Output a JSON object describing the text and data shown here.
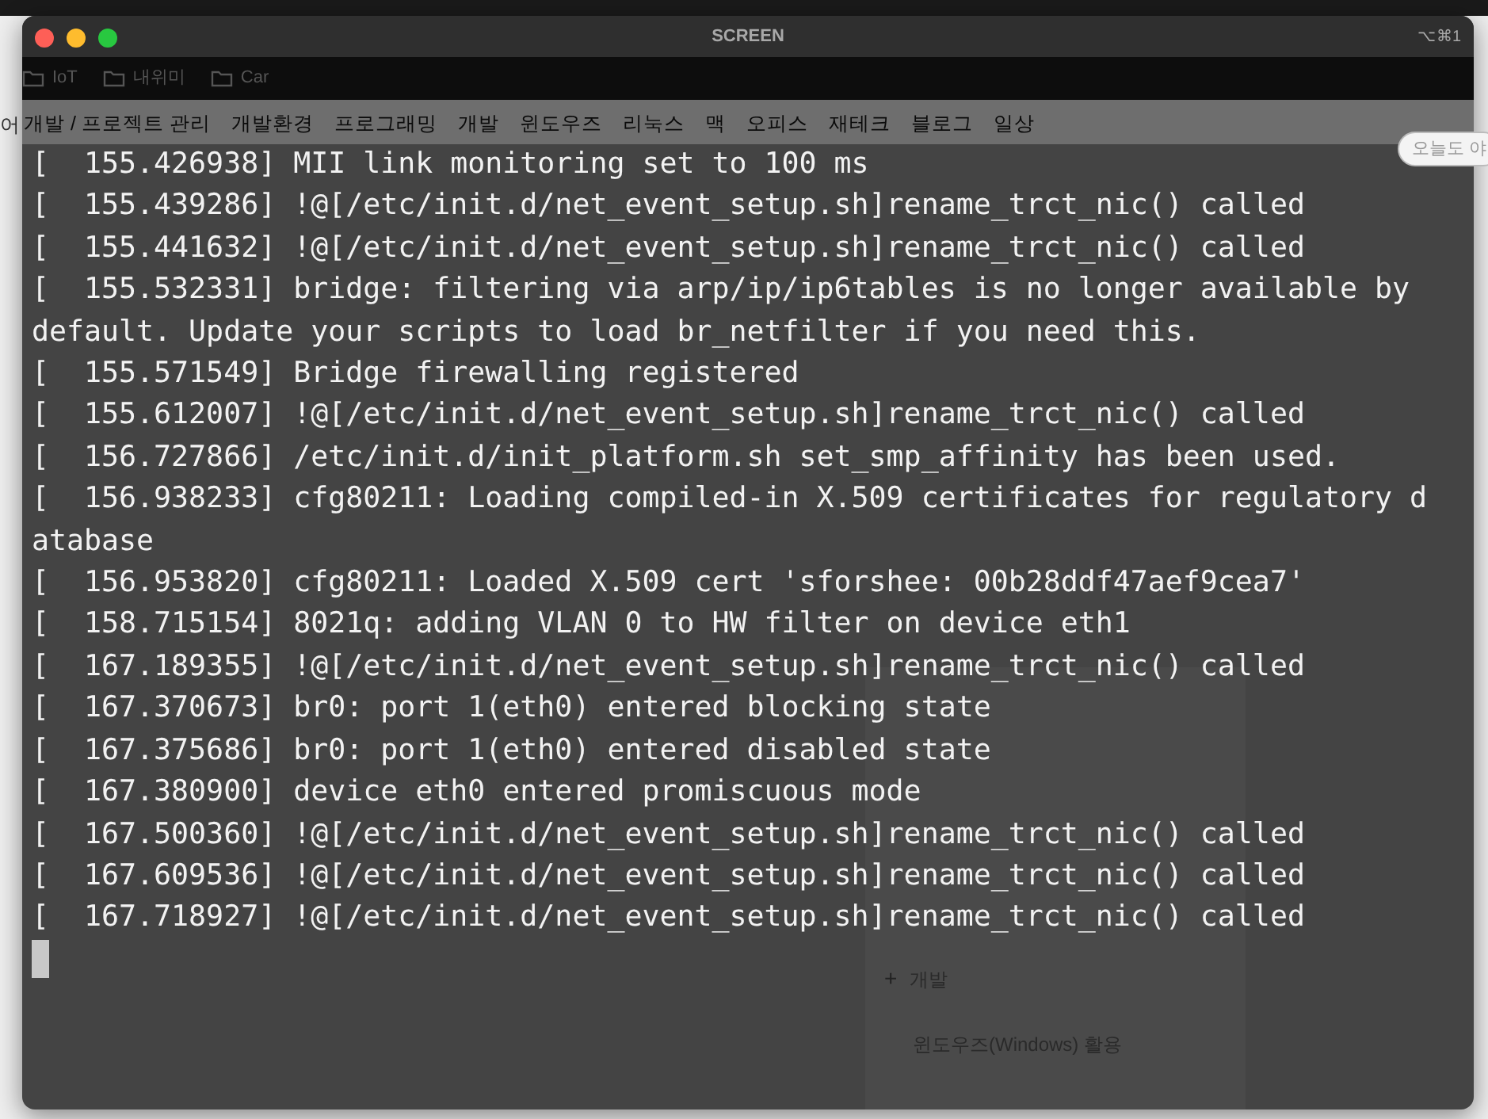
{
  "browser": {
    "nav_cut": "어",
    "badge": "오늘도 야",
    "bookmarks": [
      {
        "label": "IoT"
      },
      {
        "label": "내위미"
      },
      {
        "label": "Car"
      }
    ],
    "nav": [
      {
        "label": "개발 / 프로젝트 관리"
      },
      {
        "label": "개발환경"
      },
      {
        "label": "프로그래밍"
      },
      {
        "label": "개발"
      },
      {
        "label": "윈도우즈"
      },
      {
        "label": "리눅스"
      },
      {
        "label": "맥"
      },
      {
        "label": "오피스"
      },
      {
        "label": "재테크"
      },
      {
        "label": "블로그"
      },
      {
        "label": "일상"
      }
    ],
    "sidebar_items": [
      {
        "kind": "expand",
        "mark": "+",
        "label": "개발"
      },
      {
        "kind": "link",
        "label": "윈도우즈(Windows) 활용"
      }
    ]
  },
  "terminal": {
    "title": "SCREEN",
    "shortcut": "⌥⌘1",
    "cursor": true,
    "lines": [
      "[  155.426938] MII link monitoring set to 100 ms",
      "[  155.439286] !@[/etc/init.d/net_event_setup.sh]rename_trct_nic() called",
      "[  155.441632] !@[/etc/init.d/net_event_setup.sh]rename_trct_nic() called",
      "[  155.532331] bridge: filtering via arp/ip/ip6tables is no longer available by",
      "default. Update your scripts to load br_netfilter if you need this.",
      "[  155.571549] Bridge firewalling registered",
      "[  155.612007] !@[/etc/init.d/net_event_setup.sh]rename_trct_nic() called",
      "[  156.727866] /etc/init.d/init_platform.sh set_smp_affinity has been used.",
      "[  156.938233] cfg80211: Loading compiled-in X.509 certificates for regulatory d",
      "atabase",
      "[  156.953820] cfg80211: Loaded X.509 cert 'sforshee: 00b28ddf47aef9cea7'",
      "[  158.715154] 8021q: adding VLAN 0 to HW filter on device eth1",
      "[  167.189355] !@[/etc/init.d/net_event_setup.sh]rename_trct_nic() called",
      "[  167.370673] br0: port 1(eth0) entered blocking state",
      "[  167.375686] br0: port 1(eth0) entered disabled state",
      "[  167.380900] device eth0 entered promiscuous mode",
      "[  167.500360] !@[/etc/init.d/net_event_setup.sh]rename_trct_nic() called",
      "[  167.609536] !@[/etc/init.d/net_event_setup.sh]rename_trct_nic() called",
      "[  167.718927] !@[/etc/init.d/net_event_setup.sh]rename_trct_nic() called"
    ]
  }
}
